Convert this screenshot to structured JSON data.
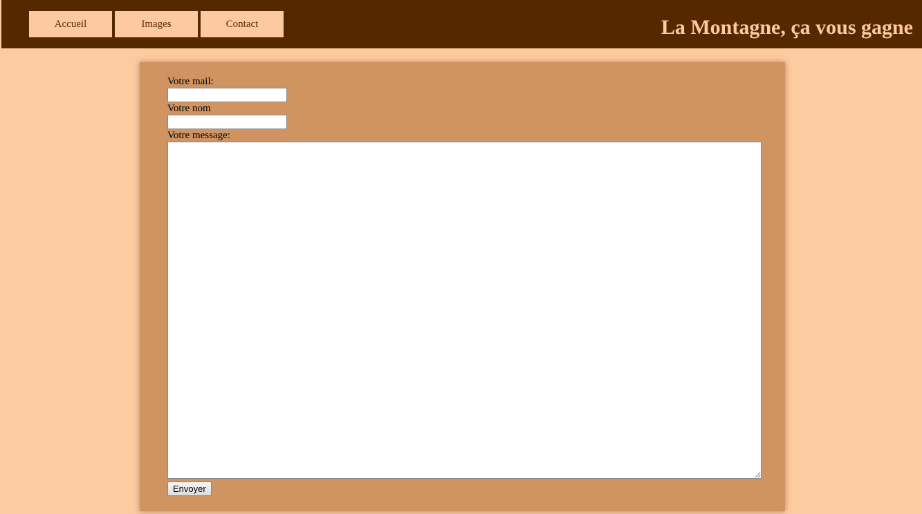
{
  "header": {
    "nav": [
      {
        "label": "Accueil"
      },
      {
        "label": "Images"
      },
      {
        "label": "Contact"
      }
    ],
    "title": "La Montagne, ça vous gagne"
  },
  "form": {
    "email_label": "Votre mail:",
    "email_value": "",
    "name_label": "Votre nom",
    "name_value": "",
    "message_label": "Votre message:",
    "message_value": "",
    "submit_label": "Envoyer"
  },
  "colors": {
    "header_bg": "#562800",
    "page_bg": "#fccba0",
    "panel_bg": "#d09462",
    "nav_bg": "#fdc9a0",
    "title_color": "#fdc9a0"
  }
}
